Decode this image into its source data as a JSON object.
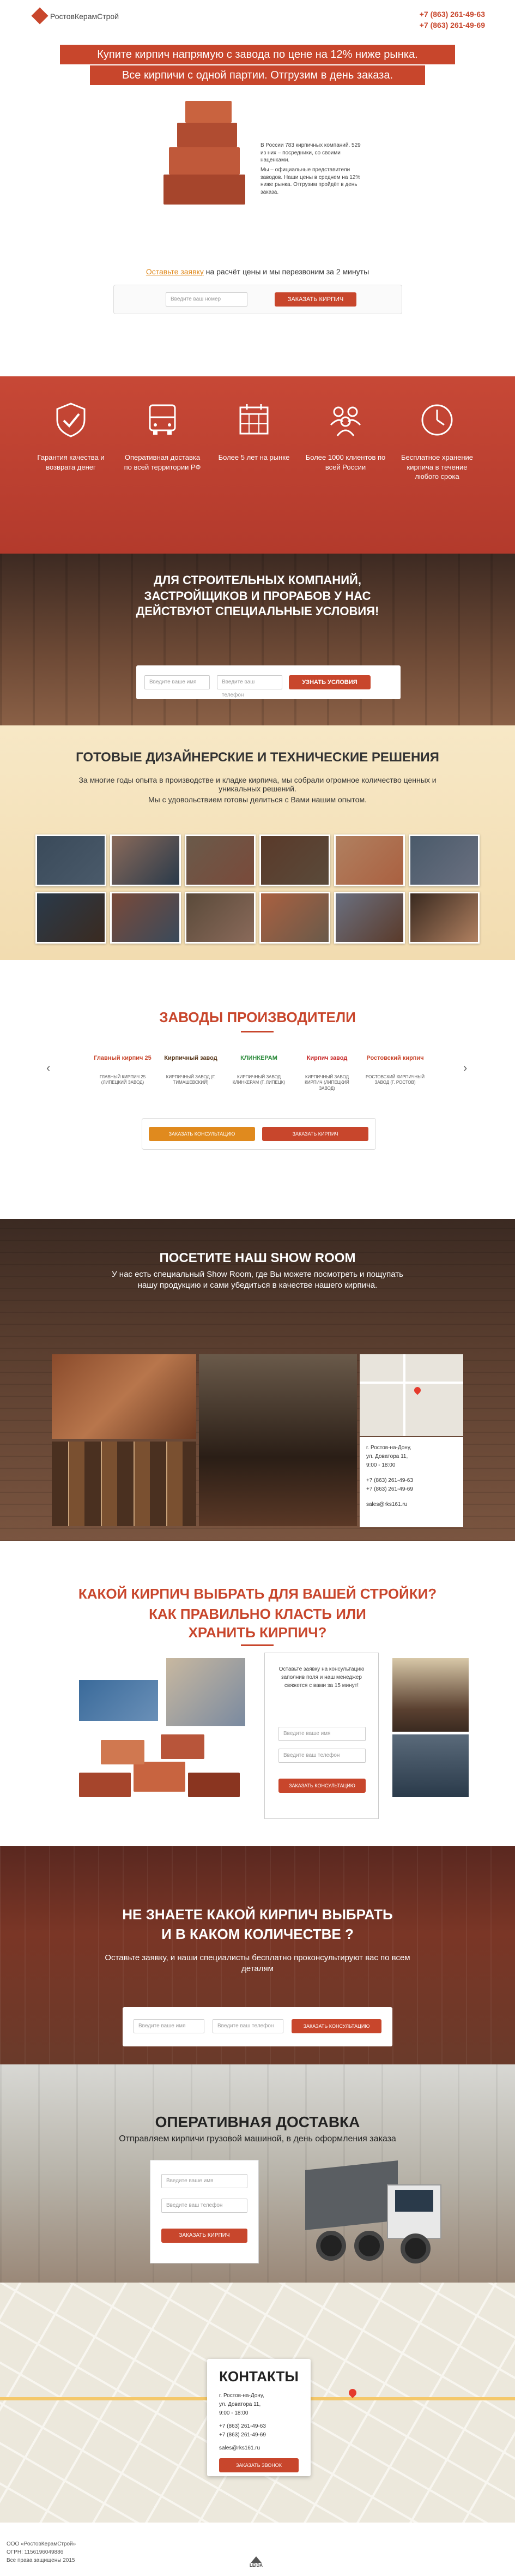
{
  "header": {
    "logo_text": "РостовКерамСтрой",
    "phone1": "+7 (863) 261-49-63",
    "phone2": "+7 (863) 261-49-69"
  },
  "hero": {
    "line1": "Купите кирпич напрямую с завода по цене на 12% ниже рынка.",
    "line2": "Все кирпичи с одной партии. Отгрузим в день заказа.",
    "text1": "В России 783 кирпичных компаний. 529 из них – посредники, со своими наценками.",
    "text2": "Мы – официальные представители заводов. Наши цены в среднем на 12% ниже рынка. Отгрузим пройдёт в день заказа.",
    "form_prefix": "Оставьте заявку",
    "form_suffix": " на расчёт цены и мы перезвоним за 2 минуты",
    "input_placeholder": "Введите ваш номер",
    "button": "Заказать кирпич"
  },
  "benefits": {
    "items": [
      {
        "icon": "shield-check-icon",
        "label": "Гарантия качества и возврата денег"
      },
      {
        "icon": "truck-icon",
        "label": "Оперативная доставка по всей территории РФ"
      },
      {
        "icon": "calendar-icon",
        "label": "Более 5 лет на рынке"
      },
      {
        "icon": "people-icon",
        "label": "Более 1000 клиентов по всей России"
      },
      {
        "icon": "clock-icon",
        "label": "Бесплатное хранение кирпича в течение любого срока"
      }
    ]
  },
  "builders": {
    "title": "Для строительных компаний, застройщиков и прорабов у нас действуют специальные условия!",
    "input1": "Введите ваше имя",
    "input2": "Введите ваш телефон",
    "button": "Узнать условия"
  },
  "design": {
    "title": "Готовые дизайнерские и технические решения",
    "text1": "За многие годы опыта в производстве и кладке кирпича, мы собрали огромное количество ценных и уникальных решений.",
    "text2": "Мы с удовольствием готовы делиться с Вами нашим опытом."
  },
  "factories": {
    "title": "Заводы производители",
    "logos": [
      {
        "name": "Главный кирпич 25",
        "caption": "Главный кирпич 25 (Липецкий завод)"
      },
      {
        "name": "Кирпичный завод",
        "caption": "Кирпичный завод (г. Тимашевский)"
      },
      {
        "name": "КЛИНКЕРАМ",
        "caption": "Кирпичный завод Клинкерам (г. Липецк)"
      },
      {
        "name": "Кирпич завод",
        "caption": "Кирпичный завод Кирпич (Липецкий завод)"
      },
      {
        "name": "Ростовский кирпич",
        "caption": "Ростовский кирпичный завод (г. Ростов)"
      }
    ],
    "button1": "Заказать консультацию",
    "button2": "Заказать кирпич"
  },
  "showroom": {
    "title": "Посетите наш Show Room",
    "text": "У нас есть специальный Show Room, где Вы можете посмотреть и пощупать нашу продукцию и сами убедиться в качестве нашего кирпича.",
    "address1": "г. Ростов-на-Дону,",
    "address2": "ул. Доватора 11,",
    "hours": "9:00 - 18:00",
    "phone1": "+7 (863) 261-49-63",
    "phone2": "+7 (863) 261-49-69",
    "email": "sales@rks161.ru"
  },
  "choose": {
    "title1": "Какой кирпич выбрать для вашей стройки?",
    "title2": "Как правильно класть или хранить кирпич?",
    "form_text": "Оставьте заявку на консультацию заполнив поля и наш менеджер свяжется с вами за 15 минут!",
    "input1": "Введите ваше имя",
    "input2": "Введите ваш телефон",
    "button": "Заказать консультацию"
  },
  "unknown": {
    "title1": "Не знаете какой кирпич выбрать",
    "title2": "и в каком количестве ?",
    "text": "Оставьте заявку, и наши специалисты бесплатно проконсультируют вас по всем деталям",
    "input1": "Введите ваше имя",
    "input2": "Введите ваш телефон",
    "button": "Заказать консультацию"
  },
  "delivery": {
    "title": "Оперативная доставка",
    "subtitle": "Отправляем кирпичи грузовой машиной, в день оформления заказа",
    "input1": "Введите ваше имя",
    "input2": "Введите ваш телефон",
    "button": "Заказать кирпич"
  },
  "contacts": {
    "title": "Контакты",
    "address1": "г. Ростов-на-Дону,",
    "address2": "ул. Доватора 11,",
    "hours": "9:00 - 18:00",
    "phone1": "+7 (863) 261-49-63",
    "phone2": "+7 (863) 261-49-69",
    "email": "sales@rks161.ru",
    "button": "Заказать звонок"
  },
  "footer": {
    "line1": "ООО «РостовКерамСтрой»",
    "line2": "ОГРН: 1156196049886",
    "line3": "Все права защищены 2015",
    "dev": "LEIDA"
  }
}
